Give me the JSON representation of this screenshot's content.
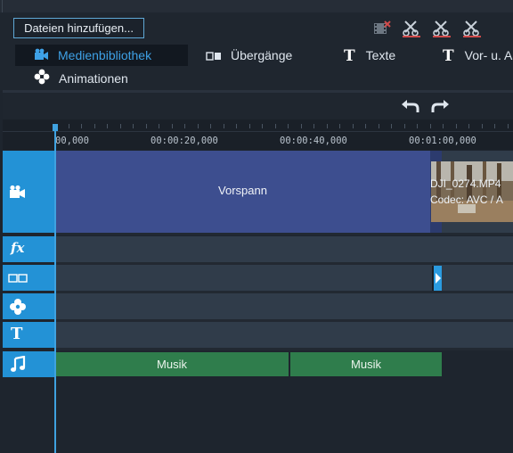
{
  "toolbar": {
    "add_files_label": "Dateien hinzufügen...",
    "icons": [
      "film-delete-icon",
      "cut-icon",
      "cut-icon",
      "cut-icon"
    ]
  },
  "tabs": [
    {
      "label": "Medienbibliothek",
      "icon": "camera-icon",
      "active": true
    },
    {
      "label": "Übergänge",
      "icon": "transition-icon",
      "active": false
    },
    {
      "label": "Texte",
      "icon": "text-icon",
      "active": false
    },
    {
      "label": "Vor- u. A",
      "icon": "text-icon",
      "active": false
    },
    {
      "label": "Animationen",
      "icon": "flower-icon",
      "active": false
    }
  ],
  "history": {
    "undo_icon": "undo-icon",
    "redo_icon": "redo-icon"
  },
  "ruler": {
    "labels": [
      "00,000",
      "00:00:20,000",
      "00:00:40,000",
      "00:01:00,000"
    ]
  },
  "tracks": [
    {
      "name": "video",
      "icon": "camera-icon"
    },
    {
      "name": "effects",
      "icon": "fx-icon"
    },
    {
      "name": "transitions",
      "icon": "transition-icon"
    },
    {
      "name": "animations",
      "icon": "flower-icon"
    },
    {
      "name": "text",
      "icon": "text-icon"
    },
    {
      "name": "music",
      "icon": "music-note-icon"
    }
  ],
  "clips": {
    "vorspann": "Vorspann",
    "dji_line1": "DJI_0274.MP4",
    "dji_line2": "Codec: AVC / A",
    "music": [
      "Musik",
      "Musik"
    ]
  },
  "colors": {
    "accent": "#2392d6",
    "video_clip": "#3d4e8f",
    "music_clip": "#2f7d4c",
    "lane": "#303c4a",
    "active_tab_text": "#3ea1e6"
  }
}
